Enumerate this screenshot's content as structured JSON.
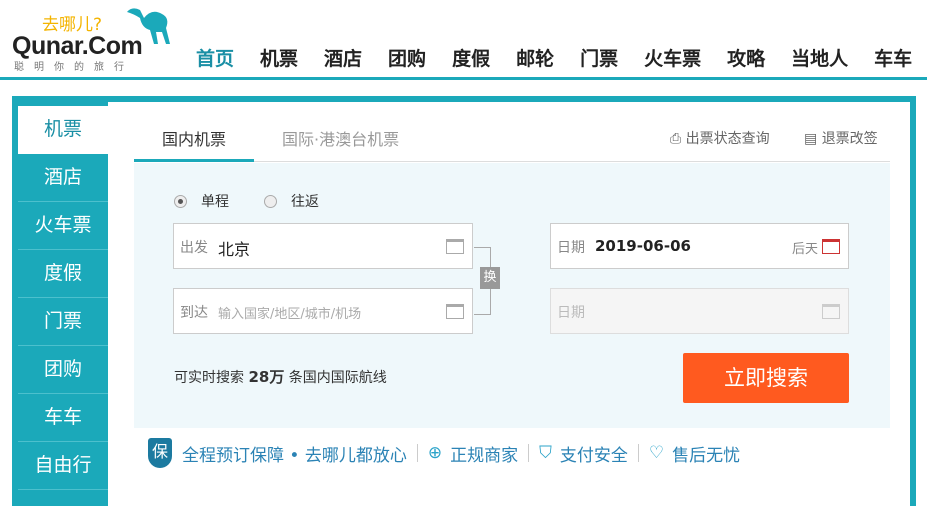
{
  "logo": {
    "wordmark": "Qunar.Com",
    "slogan_top": "去哪儿?",
    "slogan_bottom": "聪明你的旅行"
  },
  "nav": [
    "首页",
    "机票",
    "酒店",
    "团购",
    "度假",
    "邮轮",
    "门票",
    "火车票",
    "攻略",
    "当地人",
    "车车"
  ],
  "sidebar": [
    "机票",
    "酒店",
    "火车票",
    "度假",
    "门票",
    "团购",
    "车车",
    "自由行"
  ],
  "tabs": {
    "domestic": "国内机票",
    "intl": "国际·港澳台机票",
    "status": "出票状态查询",
    "refund": "退票改签"
  },
  "trip": {
    "oneway": "单程",
    "round": "往返",
    "selected": "oneway"
  },
  "form": {
    "from_label": "出发",
    "from_value": "北京",
    "to_label": "到达",
    "to_placeholder": "输入国家/地区/城市/机场",
    "date_label": "日期",
    "date_value": "2019-06-06",
    "date_hint": "后天",
    "return_label": "日期",
    "swap": "换"
  },
  "count": {
    "prefix": "可实时搜索",
    "num": "28万",
    "suffix": "条国内国际航线"
  },
  "search_button": "立即搜索",
  "guarantee": {
    "badge": "保",
    "main": "全程预订保障 • 去哪儿都放心",
    "items": [
      "正规商家",
      "支付安全",
      "售后无忧"
    ]
  },
  "colors": {
    "teal": "#1ba9ba",
    "orange": "#ff5a1f"
  }
}
